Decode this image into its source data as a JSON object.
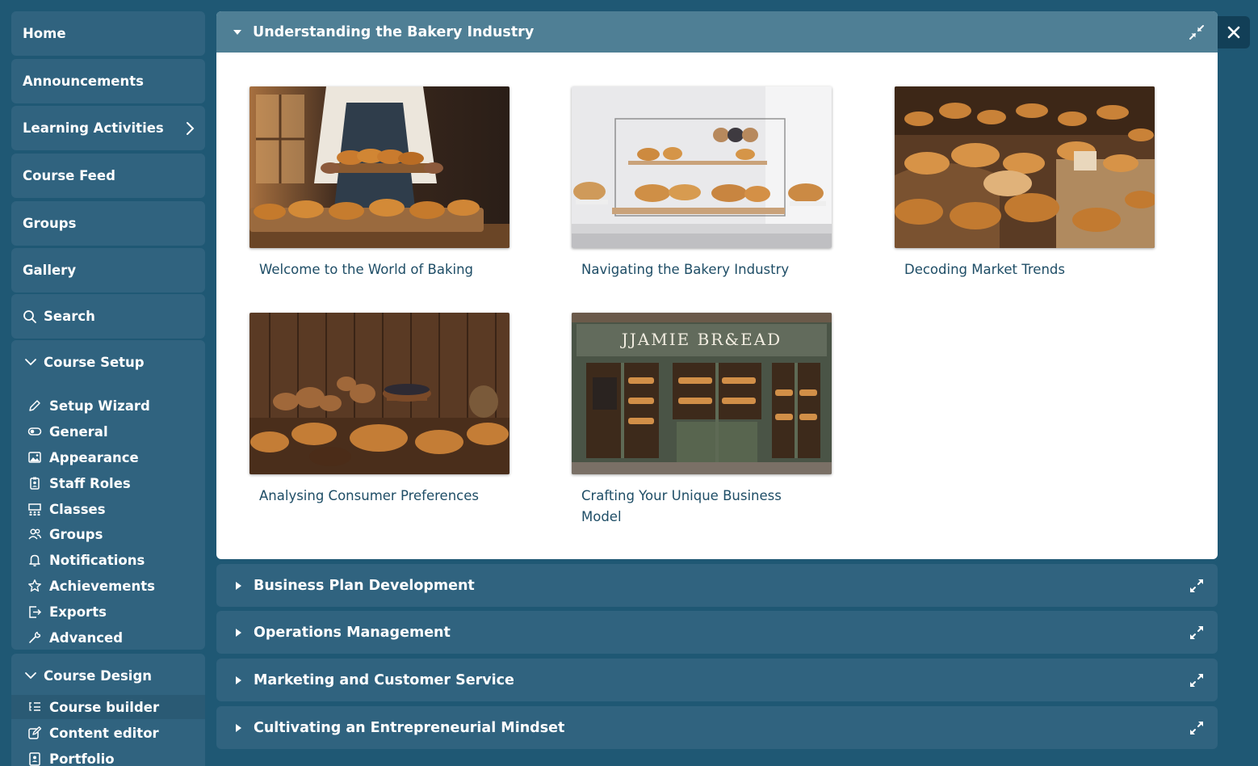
{
  "sidebar": {
    "nav": [
      {
        "label": "Home"
      },
      {
        "label": "Announcements"
      },
      {
        "label": "Learning Activities"
      },
      {
        "label": "Course Feed"
      },
      {
        "label": "Groups"
      },
      {
        "label": "Gallery"
      },
      {
        "label": "Search"
      }
    ],
    "course_setup": {
      "heading": "Course Setup",
      "items": [
        {
          "label": "Setup Wizard",
          "icon": "pencil-icon"
        },
        {
          "label": "General",
          "icon": "toggle-icon"
        },
        {
          "label": "Appearance",
          "icon": "image-icon"
        },
        {
          "label": "Staff Roles",
          "icon": "id-badge-icon"
        },
        {
          "label": "Classes",
          "icon": "classroom-icon"
        },
        {
          "label": "Groups",
          "icon": "users-icon"
        },
        {
          "label": "Notifications",
          "icon": "bell-icon"
        },
        {
          "label": "Achievements",
          "icon": "star-icon"
        },
        {
          "label": "Exports",
          "icon": "export-icon"
        },
        {
          "label": "Advanced",
          "icon": "wrench-icon"
        }
      ]
    },
    "course_design": {
      "heading": "Course Design",
      "items": [
        {
          "label": "Course builder",
          "icon": "list-tree-icon",
          "active": true
        },
        {
          "label": "Content editor",
          "icon": "edit-icon"
        },
        {
          "label": "Portfolio",
          "icon": "portfolio-icon"
        }
      ]
    }
  },
  "main": {
    "open_section": {
      "title": "Understanding the Bakery Industry",
      "cards": [
        {
          "title": "Welcome to the World of Baking",
          "image": "baker-croissants"
        },
        {
          "title": "Navigating the Bakery Industry",
          "image": "pastry-display-case"
        },
        {
          "title": "Decoding Market Trends",
          "image": "bread-market"
        },
        {
          "title": "Analysing Consumer Preferences",
          "image": "bread-table-wood"
        },
        {
          "title": "Crafting Your Unique Business Model",
          "image": "bakery-storefront",
          "shop_sign": "JJAMIE BR&EAD"
        }
      ]
    },
    "sections": [
      {
        "title": "Business Plan Development"
      },
      {
        "title": "Operations Management"
      },
      {
        "title": "Marketing and Customer Service"
      },
      {
        "title": "Cultivating an Entrepreneurial Mindset"
      }
    ]
  },
  "colors": {
    "background": "#1f5874",
    "sidebar_button": "#30637f",
    "open_header": "#4f7f95",
    "card_title": "#1e4d66",
    "close_button": "#123f57"
  }
}
